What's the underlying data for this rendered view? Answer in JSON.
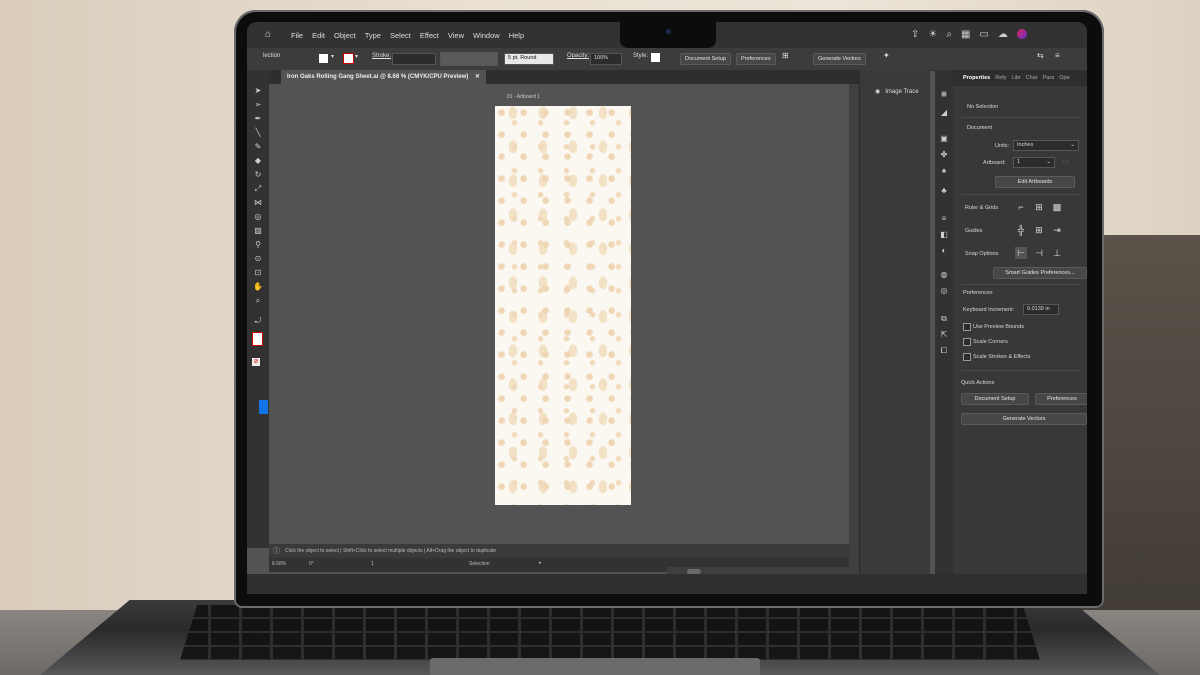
{
  "menubar": {
    "items": [
      "File",
      "Edit",
      "Object",
      "Type",
      "Select",
      "Effect",
      "View",
      "Window",
      "Help"
    ]
  },
  "control": {
    "selection_label": "lection",
    "stroke_label": "Stroke:",
    "stroke_value": "",
    "brush_value": "5 pt. Round",
    "opacity_label": "Opacity:",
    "opacity_value": "100%",
    "style_label": "Style:",
    "document_setup": "Document Setup",
    "preferences": "Preferences",
    "generate_vectors": "Generate Vectors"
  },
  "document": {
    "tab_title": "Iron Oaks Rolling Gang Sheet.ai @ 8.68 % (CMYK/CPU Preview)",
    "artboard_label": "01 - Artboard 1"
  },
  "status": {
    "hint": "Click the object to select  |  Shift+Click to select multiple objects  |  Alt+Drag the object to duplicate",
    "zoom": "8.68%",
    "rotation": "0°",
    "artboard_num": "1",
    "tool": "Selection"
  },
  "midpanel": {
    "image_trace": "Image Trace"
  },
  "properties": {
    "tabs": [
      "Properties",
      "Refy",
      "Libr",
      "Char",
      "Para",
      "Ope"
    ],
    "no_selection": "No Selection",
    "document_heading": "Document",
    "units_label": "Units:",
    "units_value": "Inches",
    "artboard_label": "Artboard:",
    "artboard_value": "1",
    "edit_artboards": "Edit Artboards",
    "ruler_grids": "Ruler & Grids",
    "guides": "Guides",
    "snap_options": "Snap Options",
    "smart_guides_prefs": "Smart Guides Preferences...",
    "preferences_heading": "Preferences",
    "keyboard_increment_label": "Keyboard Increment:",
    "keyboard_increment_value": "0.0139 in",
    "use_preview_bounds": "Use Preview Bounds",
    "scale_corners": "Scale Corners",
    "scale_strokes": "Scale Strokes & Effects",
    "quick_actions": "Quick Actions",
    "qa_document_setup": "Document Setup",
    "qa_preferences": "Preferences",
    "qa_generate_vectors": "Generate Vectors"
  },
  "colors": {
    "accent": "#1473e6",
    "panel": "#383838",
    "canvas": "#535353",
    "artboard": "#fbf7f1"
  }
}
